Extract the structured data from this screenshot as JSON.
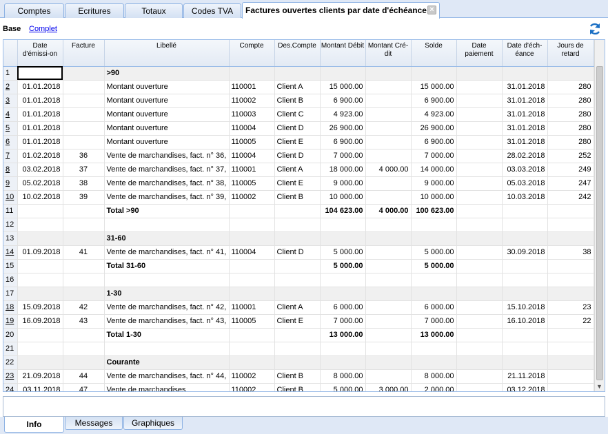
{
  "tabs": [
    {
      "label": "Comptes"
    },
    {
      "label": "Ecritures"
    },
    {
      "label": "Totaux"
    },
    {
      "label": "Codes TVA"
    },
    {
      "label": "Factures ouvertes clients par date d'échéance"
    }
  ],
  "tab_close_glyph": "×",
  "views": {
    "active": "Base",
    "other": "Complet"
  },
  "columns": [
    "Date d'émissi-on",
    "Facture",
    "Libellé",
    "Compte",
    "Des.Compte",
    "Montant Débit",
    "Montant Cré-dit",
    "Solde",
    "Date paiement",
    "Date d'éch-éance",
    "Jours de retard"
  ],
  "rows": [
    {
      "n": "1",
      "cells": [
        "",
        "",
        ">90",
        "",
        "",
        "",
        "",
        "",
        "",
        "",
        ""
      ],
      "kind": "header"
    },
    {
      "n": "2",
      "cells": [
        "01.01.2018",
        "",
        "Montant ouverture",
        "110001",
        "Client A",
        "15 000.00",
        "",
        "15 000.00",
        "",
        "31.01.2018",
        "280"
      ],
      "kind": "data"
    },
    {
      "n": "3",
      "cells": [
        "01.01.2018",
        "",
        "Montant ouverture",
        "110002",
        "Client B",
        "6 900.00",
        "",
        "6 900.00",
        "",
        "31.01.2018",
        "280"
      ],
      "kind": "data"
    },
    {
      "n": "4",
      "cells": [
        "01.01.2018",
        "",
        "Montant ouverture",
        "110003",
        "Client C",
        "4 923.00",
        "",
        "4 923.00",
        "",
        "31.01.2018",
        "280"
      ],
      "kind": "data"
    },
    {
      "n": "5",
      "cells": [
        "01.01.2018",
        "",
        "Montant ouverture",
        "110004",
        "Client D",
        "26 900.00",
        "",
        "26 900.00",
        "",
        "31.01.2018",
        "280"
      ],
      "kind": "data"
    },
    {
      "n": "6",
      "cells": [
        "01.01.2018",
        "",
        "Montant ouverture",
        "110005",
        "Client E",
        "6 900.00",
        "",
        "6 900.00",
        "",
        "31.01.2018",
        "280"
      ],
      "kind": "data"
    },
    {
      "n": "7",
      "cells": [
        "01.02.2018",
        "36",
        "Vente de marchandises, fact. n° 36,",
        "110004",
        "Client D",
        "7 000.00",
        "",
        "7 000.00",
        "",
        "28.02.2018",
        "252"
      ],
      "kind": "data"
    },
    {
      "n": "8",
      "cells": [
        "03.02.2018",
        "37",
        "Vente de marchandises, fact. n° 37,",
        "110001",
        "Client A",
        "18 000.00",
        "4 000.00",
        "14 000.00",
        "",
        "03.03.2018",
        "249"
      ],
      "kind": "data"
    },
    {
      "n": "9",
      "cells": [
        "05.02.2018",
        "38",
        "Vente de marchandises, fact. n° 38,",
        "110005",
        "Client E",
        "9 000.00",
        "",
        "9 000.00",
        "",
        "05.03.2018",
        "247"
      ],
      "kind": "data"
    },
    {
      "n": "10",
      "cells": [
        "10.02.2018",
        "39",
        "Vente de marchandises, fact. n° 39,",
        "110002",
        "Client B",
        "10 000.00",
        "",
        "10 000.00",
        "",
        "10.03.2018",
        "242"
      ],
      "kind": "data"
    },
    {
      "n": "11",
      "cells": [
        "",
        "",
        "Total >90",
        "",
        "",
        "104 623.00",
        "4 000.00",
        "100 623.00",
        "",
        "",
        ""
      ],
      "kind": "total"
    },
    {
      "n": "12",
      "cells": [
        "",
        "",
        "",
        "",
        "",
        "",
        "",
        "",
        "",
        "",
        ""
      ],
      "kind": "empty"
    },
    {
      "n": "13",
      "cells": [
        "",
        "",
        "31-60",
        "",
        "",
        "",
        "",
        "",
        "",
        "",
        ""
      ],
      "kind": "header"
    },
    {
      "n": "14",
      "cells": [
        "01.09.2018",
        "41",
        "Vente de marchandises, fact. n° 41,",
        "110004",
        "Client D",
        "5 000.00",
        "",
        "5 000.00",
        "",
        "30.09.2018",
        "38"
      ],
      "kind": "data"
    },
    {
      "n": "15",
      "cells": [
        "",
        "",
        "Total 31-60",
        "",
        "",
        "5 000.00",
        "",
        "5 000.00",
        "",
        "",
        ""
      ],
      "kind": "total"
    },
    {
      "n": "16",
      "cells": [
        "",
        "",
        "",
        "",
        "",
        "",
        "",
        "",
        "",
        "",
        ""
      ],
      "kind": "empty"
    },
    {
      "n": "17",
      "cells": [
        "",
        "",
        "1-30",
        "",
        "",
        "",
        "",
        "",
        "",
        "",
        ""
      ],
      "kind": "header"
    },
    {
      "n": "18",
      "cells": [
        "15.09.2018",
        "42",
        "Vente de marchandises, fact. n° 42,",
        "110001",
        "Client A",
        "6 000.00",
        "",
        "6 000.00",
        "",
        "15.10.2018",
        "23"
      ],
      "kind": "data"
    },
    {
      "n": "19",
      "cells": [
        "16.09.2018",
        "43",
        "Vente de marchandises, fact. n° 43,",
        "110005",
        "Client E",
        "7 000.00",
        "",
        "7 000.00",
        "",
        "16.10.2018",
        "22"
      ],
      "kind": "data"
    },
    {
      "n": "20",
      "cells": [
        "",
        "",
        "Total 1-30",
        "",
        "",
        "13 000.00",
        "",
        "13 000.00",
        "",
        "",
        ""
      ],
      "kind": "total"
    },
    {
      "n": "21",
      "cells": [
        "",
        "",
        "",
        "",
        "",
        "",
        "",
        "",
        "",
        "",
        ""
      ],
      "kind": "empty"
    },
    {
      "n": "22",
      "cells": [
        "",
        "",
        "Courante",
        "",
        "",
        "",
        "",
        "",
        "",
        "",
        ""
      ],
      "kind": "header"
    },
    {
      "n": "23",
      "cells": [
        "21.09.2018",
        "44",
        "Vente de marchandises, fact. n° 44,",
        "110002",
        "Client B",
        "8 000.00",
        "",
        "8 000.00",
        "",
        "21.11.2018",
        ""
      ],
      "kind": "data"
    },
    {
      "n": "24",
      "cells": [
        "03.11.2018",
        "47",
        "Vente de marchandises",
        "110002",
        "Client B",
        "5 000.00",
        "3 000.00",
        "2 000.00",
        "",
        "03.12.2018",
        ""
      ],
      "kind": "data"
    }
  ],
  "bottom_tabs": [
    {
      "label": "Info"
    },
    {
      "label": "Messages"
    },
    {
      "label": "Graphiques"
    }
  ],
  "colors": {
    "accent": "#1a6fc4",
    "tab_border": "#8db2e3",
    "header_bg": "#e3eaf4"
  }
}
